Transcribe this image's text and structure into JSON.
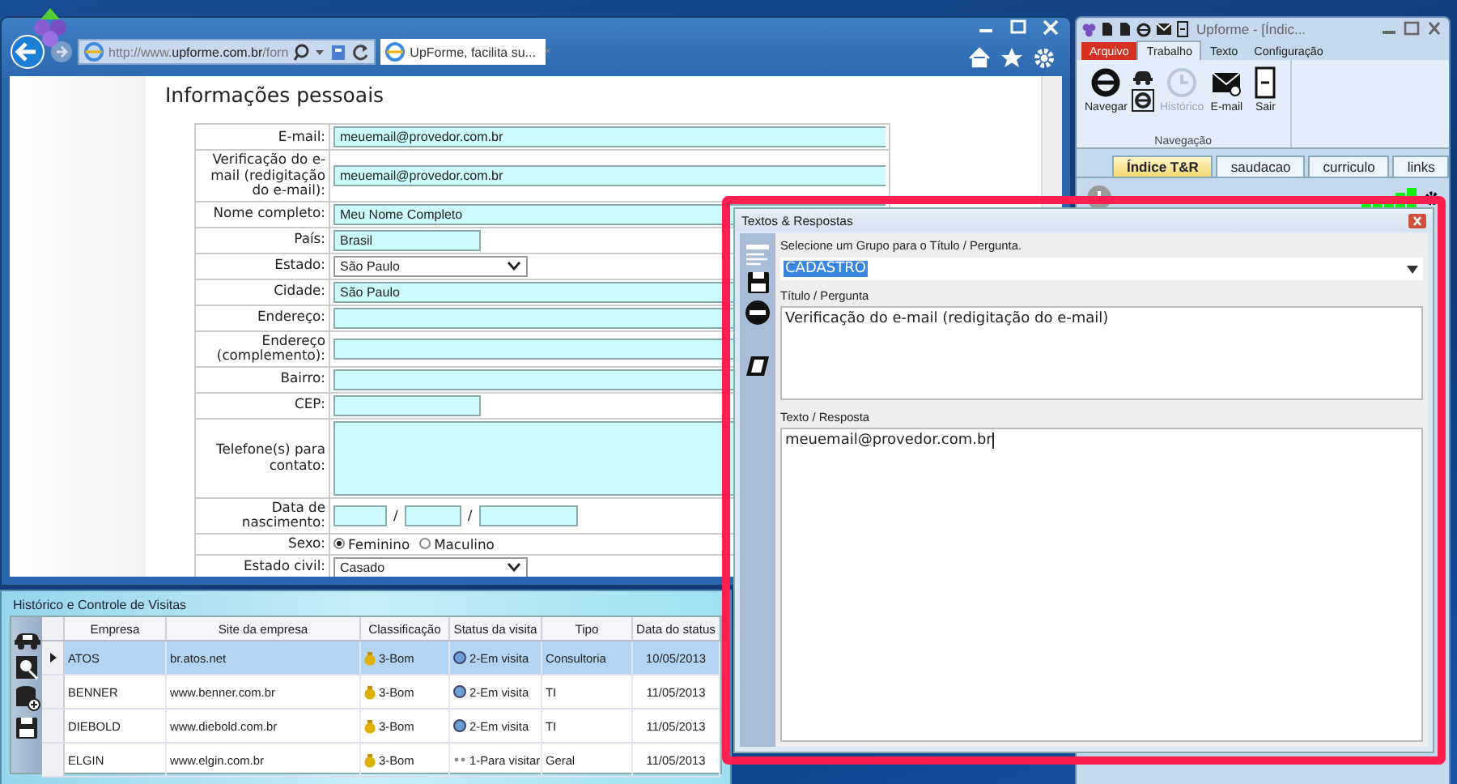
{
  "browser": {
    "address": "http://www.**upforme.com.br**/forn",
    "tab": {
      "label": "UpForme, facilita su...",
      "close": "×"
    }
  },
  "form": {
    "title": "Informações pessoais",
    "rows": [
      {
        "label": "E-mail:",
        "kind": "text",
        "value": "meuemail@provedor.com.br"
      },
      {
        "label": "Verificação do e-mail (redigitação do e-mail):",
        "kind": "text",
        "value": "meuemail@provedor.com.br"
      },
      {
        "label": "Nome completo:",
        "kind": "text",
        "value": "Meu Nome Completo"
      },
      {
        "label": "País:",
        "kind": "short",
        "value": "Brasil"
      },
      {
        "label": "Estado:",
        "kind": "select",
        "value": "São Paulo"
      },
      {
        "label": "Cidade:",
        "kind": "text",
        "value": "São Paulo"
      },
      {
        "label": "Endereço:",
        "kind": "text"
      },
      {
        "label": "Endereço (complemento):",
        "kind": "text"
      },
      {
        "label": "Bairro:",
        "kind": "text"
      },
      {
        "label": "CEP:",
        "kind": "short"
      },
      {
        "label": "Telefone(s) para contato:",
        "kind": "area"
      },
      {
        "label": "Data de nascimento:",
        "kind": "date",
        "separators": [
          "/",
          "/"
        ]
      },
      {
        "label": "Sexo:",
        "kind": "radio",
        "options": [
          {
            "label": "Feminino",
            "selected": true
          },
          {
            "label": "Maculino",
            "selected": false
          }
        ]
      },
      {
        "label": "Estado civil:",
        "kind": "select",
        "value": "Casado"
      }
    ]
  },
  "visits": {
    "title": "Histórico e Controle de Visitas",
    "columns": [
      "Empresa",
      "Site da empresa",
      "Classificação",
      "Status da visita",
      "Tipo",
      "Data do status"
    ],
    "rows": [
      {
        "selected": true,
        "kind": "visiting",
        "cells": [
          "ATOS",
          "br.atos.net",
          "3-Bom",
          "2-Em visita",
          "Consultoria",
          "10/05/2013"
        ]
      },
      {
        "selected": false,
        "kind": "visiting",
        "cells": [
          "BENNER",
          "www.benner.com.br",
          "3-Bom",
          "2-Em visita",
          "TI",
          "11/05/2013"
        ]
      },
      {
        "selected": false,
        "kind": "visiting",
        "cells": [
          "DIEBOLD",
          "www.diebold.com.br",
          "3-Bom",
          "2-Em visita",
          "TI",
          "11/05/2013"
        ]
      },
      {
        "selected": false,
        "kind": "planned",
        "cells": [
          "ELGIN",
          "www.elgin.com.br",
          "3-Bom",
          "1-Para visitar",
          "Geral",
          "11/05/2013"
        ]
      }
    ]
  },
  "app": {
    "title": "Upforme - [Índic...",
    "ribbon_tabs": [
      {
        "label": "Arquivo",
        "kind": "file",
        "selected": false
      },
      {
        "label": "Trabalho",
        "kind": "tab",
        "selected": true
      },
      {
        "label": "Texto",
        "kind": "tab",
        "selected": false
      },
      {
        "label": "Configuração",
        "kind": "tab",
        "selected": false
      }
    ],
    "buttons": [
      {
        "label": "Navegar",
        "kind": "browse",
        "disabled": false
      },
      {
        "label": "Histórico",
        "kind": "history",
        "disabled": true
      },
      {
        "label": "E-mail",
        "kind": "mail",
        "disabled": false
      },
      {
        "label": "Sair",
        "kind": "exit",
        "disabled": false
      }
    ],
    "group": "Navegação",
    "doc_tabs": [
      {
        "label": "Índice T&R",
        "selected": true
      },
      {
        "label": "saudacao",
        "selected": false
      },
      {
        "label": "curriculo",
        "selected": false
      },
      {
        "label": "links",
        "selected": false
      }
    ]
  },
  "dialog": {
    "title": "Textos & Respostas",
    "highlighted": true,
    "group_prompt": "Selecione um Grupo para o Título / Pergunta.",
    "group_value": "CADASTRO",
    "title_label": "Título / Pergunta",
    "title_value": "Verificação do e-mail (redigitação do e-mail)",
    "answer_label": "Texto / Resposta",
    "answer_value": "meuemail@provedor.com.br"
  }
}
